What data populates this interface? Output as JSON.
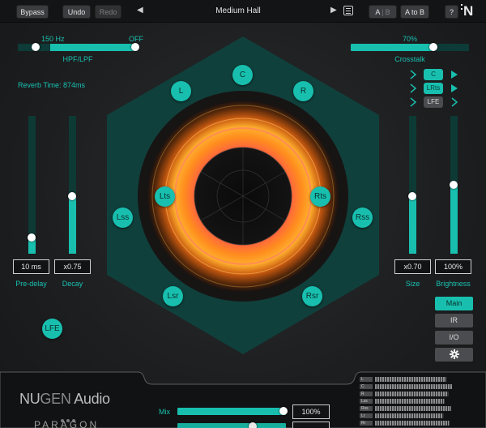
{
  "toolbar": {
    "bypass": "Bypass",
    "undo": "Undo",
    "redo": "Redo",
    "preset_name": "Medium Hall",
    "prev_icon": "triangle-left-icon",
    "next_icon": "triangle-right-icon",
    "list_icon": "list-icon",
    "ab_a": "A",
    "ab_sep": "|",
    "ab_b": "B",
    "a_to_b": "A to B",
    "help": "?",
    "logo": "N"
  },
  "filter": {
    "low_value": "150 Hz",
    "high_value": "OFF",
    "label": "HPF/LPF",
    "low_pos": 0.15,
    "high_pos": 1.0
  },
  "reverb_time": "Reverb Time: 874ms",
  "crosstalk": {
    "value": "70%",
    "label": "Crosstalk",
    "level": 0.7
  },
  "predelay": {
    "value": "10 ms",
    "label": "Pre-delay",
    "level": 0.12
  },
  "decay": {
    "value": "x0.75",
    "label": "Decay",
    "level": 0.42
  },
  "size": {
    "value": "x0.70",
    "label": "Size",
    "level": 0.42
  },
  "brightness": {
    "value": "100%",
    "label": "Brightness",
    "level": 0.5
  },
  "output_channels": [
    {
      "label": "C",
      "state": "on"
    },
    {
      "label": "LRts",
      "state": "on"
    },
    {
      "label": "LFE",
      "state": "off"
    }
  ],
  "speakers": [
    "C",
    "L",
    "R",
    "Lts",
    "Rts",
    "Lss",
    "Rss",
    "Lsr",
    "Rsr",
    "LFE"
  ],
  "side_buttons": {
    "main": "Main",
    "ir": "IR",
    "io": "I/O",
    "settings_icon": "gear-icon"
  },
  "brand": {
    "nu": "NU",
    "gen": "GEN",
    "audio": " Audio",
    "product": "PARAGON"
  },
  "mix": {
    "label": "Mix",
    "value": "100%",
    "level": 1.0
  },
  "meters": {
    "labels": [
      "L",
      "C",
      "R",
      "Lss",
      "Rss",
      "Lr",
      "Rr"
    ],
    "levels": [
      0.72,
      0.78,
      0.74,
      0.7,
      0.77,
      0.69,
      0.75
    ]
  },
  "colors": {
    "accent": "#18bfae",
    "background": "#1c1d1f",
    "hexagon": "#10403c",
    "glow": "#ff8a1c"
  }
}
